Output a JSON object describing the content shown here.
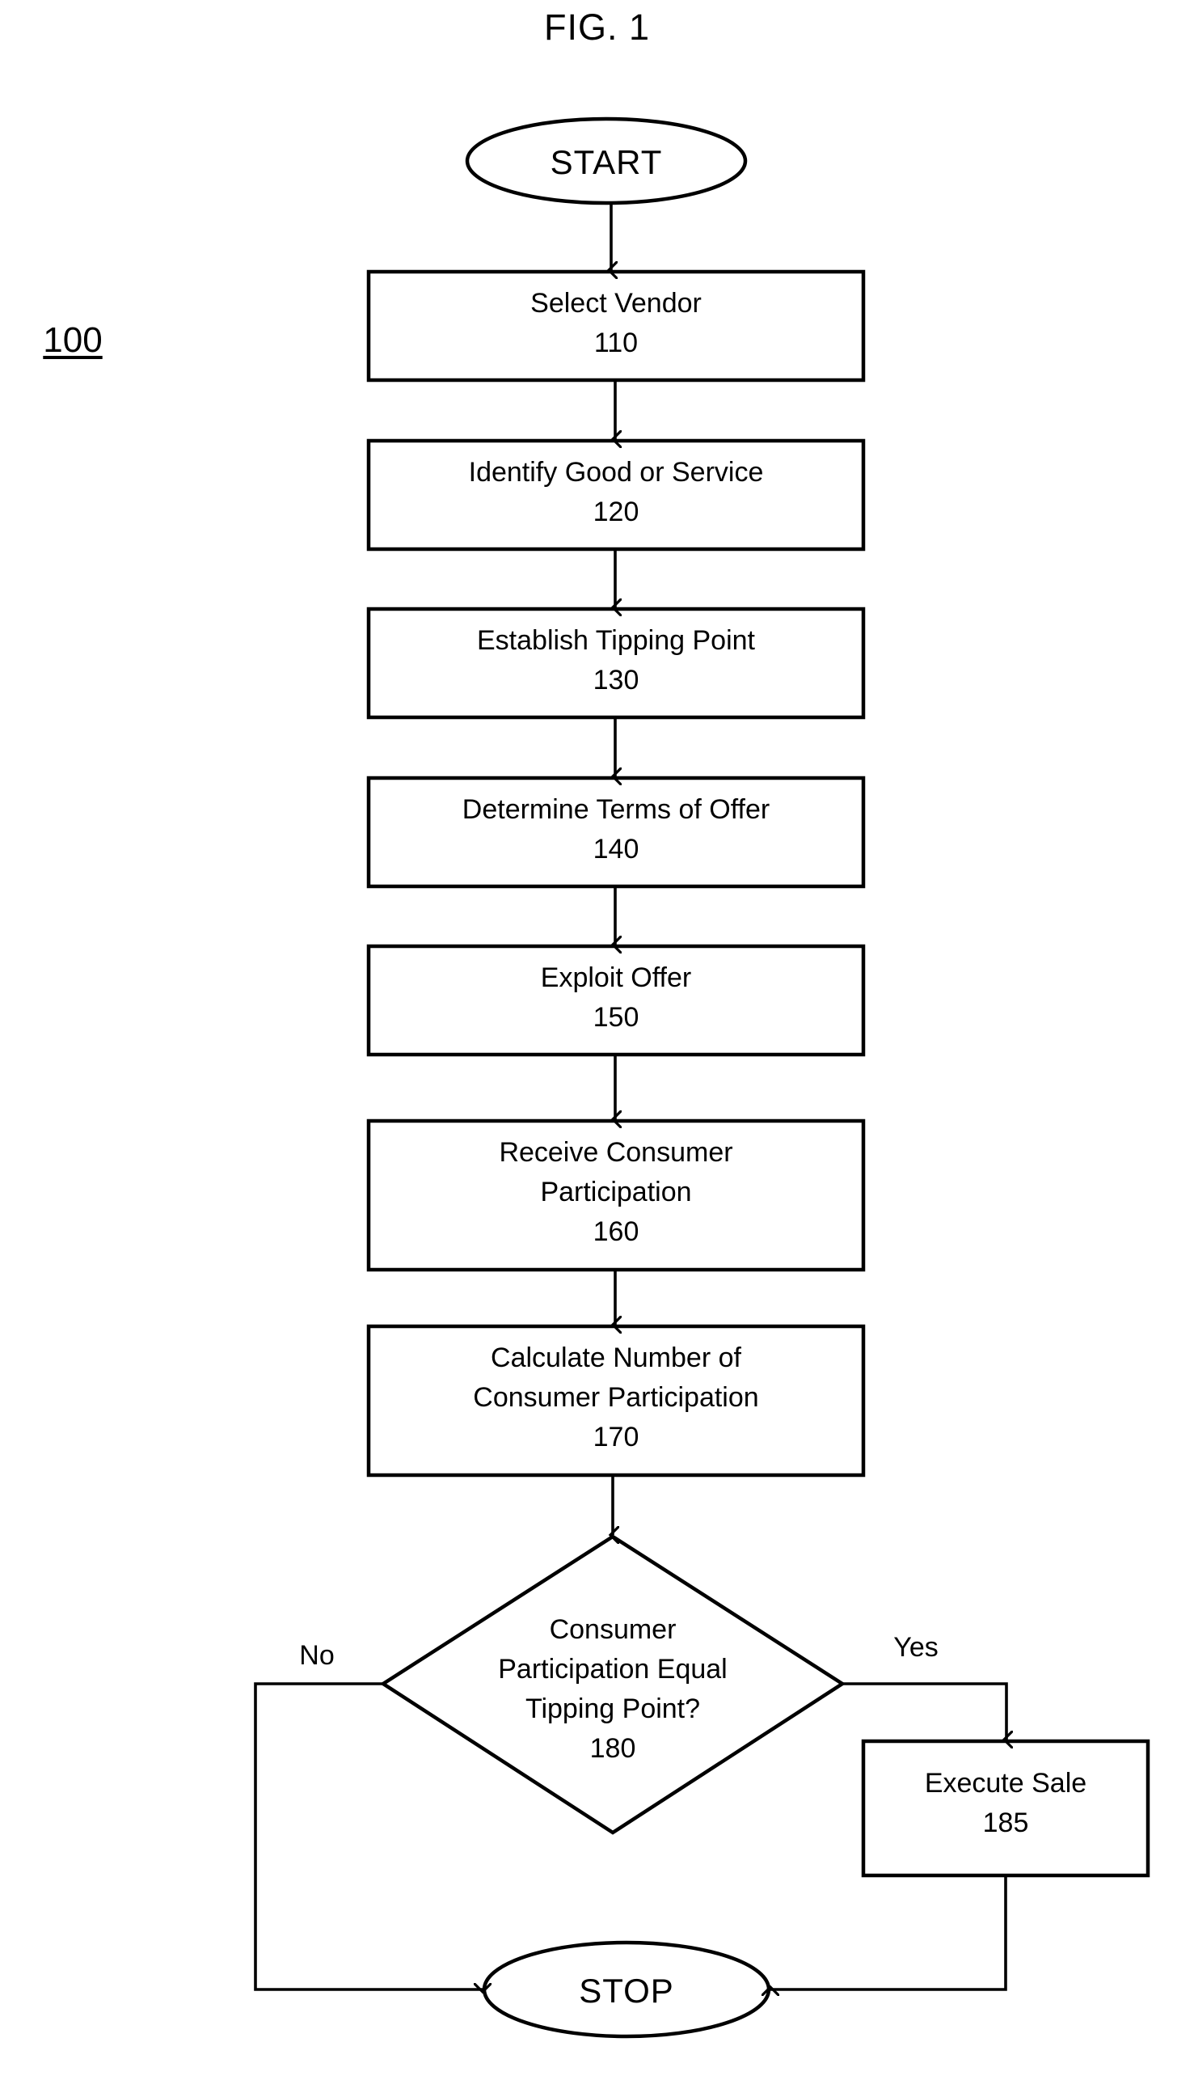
{
  "figure": {
    "title": "FIG. 1",
    "reference_numeral": "100",
    "type": "flowchart"
  },
  "nodes": {
    "start": {
      "shape": "ellipse",
      "label": "START"
    },
    "step_110": {
      "shape": "process",
      "text": "Select Vendor",
      "ref": "110"
    },
    "step_120": {
      "shape": "process",
      "text": "Identify Good or Service",
      "ref": "120"
    },
    "step_130": {
      "shape": "process",
      "text": "Establish Tipping Point",
      "ref": "130"
    },
    "step_140": {
      "shape": "process",
      "text": "Determine Terms of Offer",
      "ref": "140"
    },
    "step_150": {
      "shape": "process",
      "text": "Exploit Offer",
      "ref": "150"
    },
    "step_160": {
      "shape": "process",
      "line1": "Receive Consumer",
      "line2": "Participation",
      "ref": "160"
    },
    "step_170": {
      "shape": "process",
      "line1": "Calculate Number of",
      "line2": "Consumer Participation",
      "ref": "170"
    },
    "step_180": {
      "shape": "decision",
      "line1": "Consumer",
      "line2": "Participation Equal",
      "line3": "Tipping Point?",
      "ref": "180"
    },
    "step_185": {
      "shape": "process",
      "text": "Execute Sale",
      "ref": "185"
    },
    "stop": {
      "shape": "ellipse",
      "label": "STOP"
    }
  },
  "branches": {
    "no_label": "No",
    "yes_label": "Yes"
  },
  "style": {
    "stroke": "#000000",
    "fill": "#ffffff",
    "background": "#ffffff"
  }
}
